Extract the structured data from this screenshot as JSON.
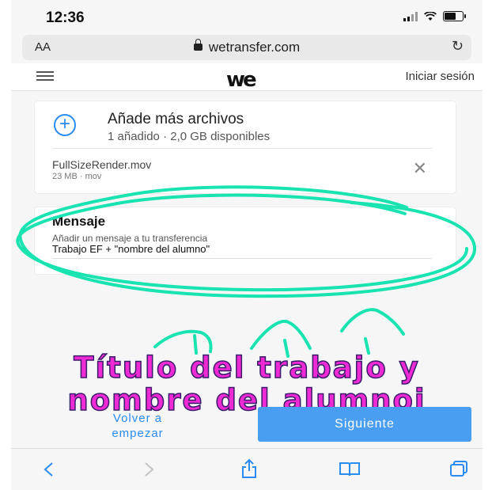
{
  "status_bar": {
    "time": "12:36"
  },
  "address_bar": {
    "text_size": "AA",
    "url": "wetransfer.com"
  },
  "header": {
    "logo": "we",
    "signin": "Iniciar sesión"
  },
  "files_card": {
    "add_title": "Añade más archivos",
    "add_subtitle": "1 añadido · 2,0 GB disponibles",
    "file": {
      "name": "FullSizeRender.mov",
      "meta": "23 MB · mov"
    }
  },
  "message_card": {
    "title": "Mensaje",
    "label": "Añadir un mensaje a tu transferencia",
    "value": "Trabajo EF + \"nombre del alumno\""
  },
  "annotation": {
    "line1": "Título del trabajo y",
    "line2": "nombre del alumnoi",
    "color": "#ee2ad4",
    "marker_color": "#19e3b0"
  },
  "actions": {
    "back_label": "Volver a empezar",
    "next_label": "Siguiente"
  },
  "toolbar": {
    "back_icon": "chevron-left-icon",
    "forward_icon": "chevron-right-icon",
    "share_icon": "share-icon",
    "bookmarks_icon": "book-icon",
    "tabs_icon": "tabs-icon"
  },
  "colors": {
    "accent": "#2a8cf0",
    "button": "#4a9ef2"
  }
}
